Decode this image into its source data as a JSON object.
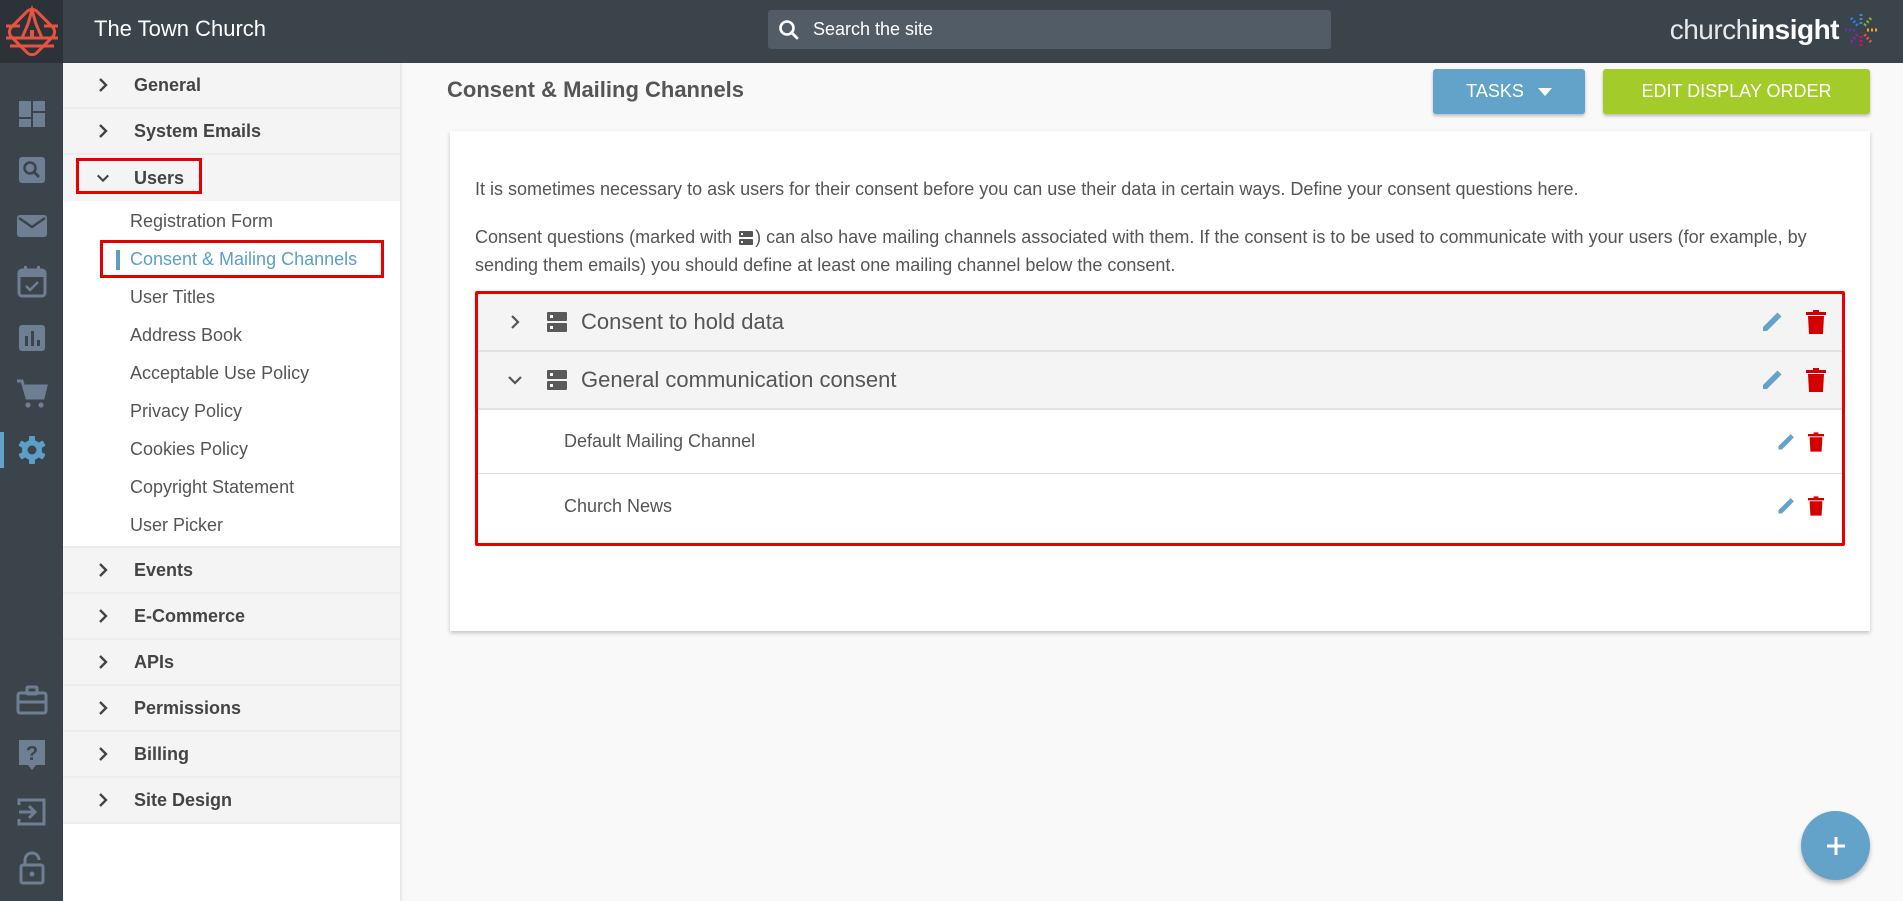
{
  "header": {
    "site_title": "The Town Church",
    "search_placeholder": "Search the site",
    "brand_light": "church",
    "brand_bold": "insight"
  },
  "rail": {
    "top_icons": [
      "dashboard-icon",
      "search-icon",
      "mail-icon",
      "calendar-check-icon",
      "bar-chart-icon",
      "cart-icon",
      "settings-icon"
    ],
    "bottom_icons": [
      "briefcase-icon",
      "help-icon",
      "sign-in-icon",
      "unlock-icon"
    ],
    "active": "settings-icon"
  },
  "sidebar": {
    "sections_before": [
      {
        "label": "General"
      },
      {
        "label": "System Emails"
      }
    ],
    "open_section": {
      "label": "Users",
      "items": [
        {
          "label": "Registration Form"
        },
        {
          "label": "Consent & Mailing Channels",
          "active": true
        },
        {
          "label": "User Titles"
        },
        {
          "label": "Address Book"
        },
        {
          "label": "Acceptable Use Policy"
        },
        {
          "label": "Privacy Policy"
        },
        {
          "label": "Cookies Policy"
        },
        {
          "label": "Copyright Statement"
        },
        {
          "label": "User Picker"
        }
      ]
    },
    "sections_after": [
      {
        "label": "Events"
      },
      {
        "label": "E-Commerce"
      },
      {
        "label": "APIs"
      },
      {
        "label": "Permissions"
      },
      {
        "label": "Billing"
      },
      {
        "label": "Site Design"
      }
    ]
  },
  "main": {
    "title": "Consent & Mailing Channels",
    "tasks_label": "TASKS",
    "edit_order_label": "EDIT DISPLAY ORDER",
    "intro1": "It is sometimes necessary to ask users for their consent before you can use their data in certain ways. Define your consent questions here.",
    "intro2_before": "Consent questions (marked with ",
    "intro2_after": ") can also have mailing channels associated with them. If the consent is to be used to communicate with your users (for example, by sending them emails) you should define at least one mailing channel below the consent.",
    "consents": [
      {
        "label": "Consent to hold data",
        "expanded": false,
        "channels": []
      },
      {
        "label": "General communication consent",
        "expanded": true,
        "channels": [
          {
            "label": "Default Mailing Channel"
          },
          {
            "label": "Church News"
          }
        ]
      }
    ]
  },
  "colors": {
    "topbar": "#3b434b",
    "accent_blue": "#63a2c9",
    "accent_green": "#a3cb2a",
    "delete_red": "#d40000",
    "highlight_red": "#e80000",
    "logo_red": "#e8533f"
  }
}
